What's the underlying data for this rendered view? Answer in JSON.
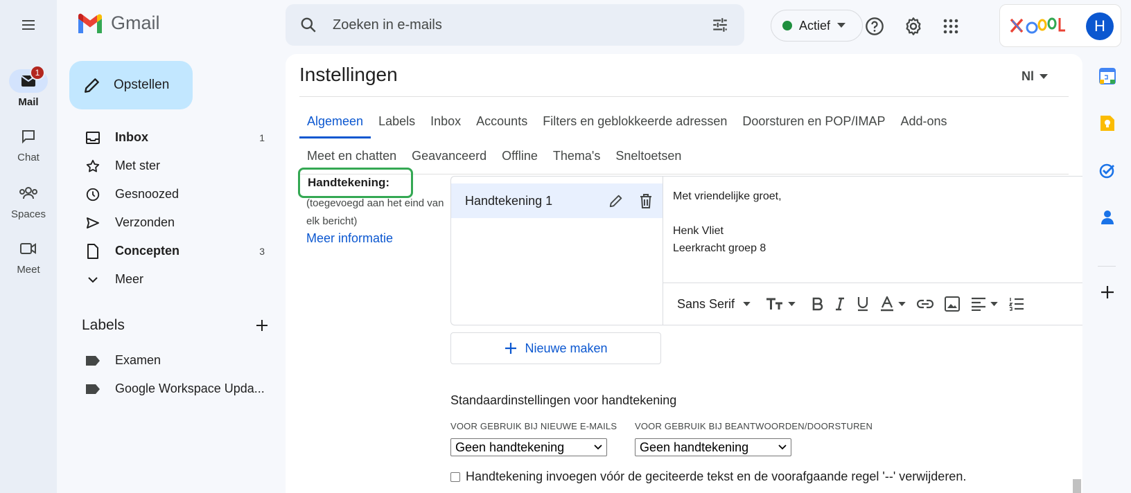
{
  "app": {
    "logo_text": "Gmail"
  },
  "rail": {
    "items": [
      {
        "label": "Mail",
        "icon": "mail-icon",
        "badge": "1",
        "active": true
      },
      {
        "label": "Chat",
        "icon": "chat-icon"
      },
      {
        "label": "Spaces",
        "icon": "spaces-icon"
      },
      {
        "label": "Meet",
        "icon": "meet-icon"
      }
    ]
  },
  "compose": {
    "label": "Opstellen"
  },
  "folders": [
    {
      "label": "Inbox",
      "count": "1",
      "bold": true,
      "icon": "inbox-icon"
    },
    {
      "label": "Met ster",
      "count": "",
      "bold": false,
      "icon": "star-icon"
    },
    {
      "label": "Gesnoozed",
      "count": "",
      "bold": false,
      "icon": "clock-icon"
    },
    {
      "label": "Verzonden",
      "count": "",
      "bold": false,
      "icon": "send-icon"
    },
    {
      "label": "Concepten",
      "count": "3",
      "bold": true,
      "icon": "draft-icon"
    },
    {
      "label": "Meer",
      "count": "",
      "bold": false,
      "icon": "chevron-down-icon"
    }
  ],
  "labels": {
    "heading": "Labels",
    "items": [
      "Examen",
      "Google Workspace Upda..."
    ]
  },
  "search": {
    "placeholder": "Zoeken in e-mails"
  },
  "status": {
    "label": "Actief",
    "color": "#1e8e3e"
  },
  "account": {
    "avatar_letter": "H"
  },
  "settings": {
    "title": "Instellingen",
    "lang": "Nl",
    "tabs_row1": [
      "Algemeen",
      "Labels",
      "Inbox",
      "Accounts",
      "Filters en geblokkeerde adressen",
      "Doorsturen en POP/IMAP",
      "Add-ons"
    ],
    "tabs_row2": [
      "Meet en chatten",
      "Geavanceerd",
      "Offline",
      "Thema's",
      "Sneltoetsen"
    ],
    "active_tab": "Algemeen",
    "signature": {
      "label": "Handtekening:",
      "note": "(toegevoegd aan het eind van elk bericht)",
      "more_info": "Meer informatie",
      "items": [
        "Handtekening 1"
      ],
      "editor_lines": [
        "Met vriendelijke groet,",
        "",
        "Henk Vliet",
        "Leerkracht groep 8"
      ],
      "font": "Sans Serif",
      "new_button": "Nieuwe maken",
      "defaults_title": "Standaardinstellingen voor handtekening",
      "new_mail_label": "VOOR GEBRUIK BIJ NIEUWE E-MAILS",
      "reply_label": "VOOR GEBRUIK BIJ BEANTWOORDEN/DOORSTUREN",
      "new_mail_value": "Geen handtekening",
      "reply_value": "Geen handtekening",
      "insert_before_quote": "Handtekening invoegen vóór de geciteerde tekst en de voorafgaande regel '--' verwijderen."
    }
  },
  "colors": {
    "accent": "#0b57d0",
    "compose_bg": "#c2e7ff",
    "highlight": "#34a853"
  }
}
